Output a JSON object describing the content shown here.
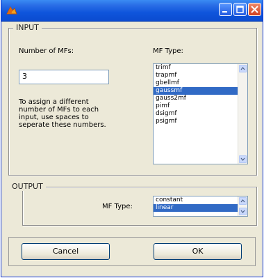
{
  "window": {
    "title": "",
    "icon": "matlab-icon",
    "controls": [
      "minimize-icon",
      "maximize-icon",
      "close-icon"
    ]
  },
  "input": {
    "legend": "INPUT",
    "num_mfs_label": "Number of MFs:",
    "num_mfs_value": "3",
    "help_text": [
      "To assign a different",
      "number of MFs to each",
      "input, use spaces to",
      "seperate these numbers."
    ],
    "mf_type_label": "MF Type:",
    "mf_types": [
      "trimf",
      "trapmf",
      "gbellmf",
      "gaussmf",
      "gauss2mf",
      "pimf",
      "dsigmf",
      "psigmf"
    ],
    "selected_index": 3
  },
  "output": {
    "legend": "OUTPUT",
    "mf_type_label": "MF Type:",
    "mf_types": [
      "constant",
      "linear"
    ],
    "selected_index": 1
  },
  "buttons": {
    "cancel": "Cancel",
    "ok": "OK"
  },
  "colors": {
    "titlebar": "#0f55dc",
    "selection": "#316ac5",
    "dialog_bg": "#ece9d8"
  }
}
